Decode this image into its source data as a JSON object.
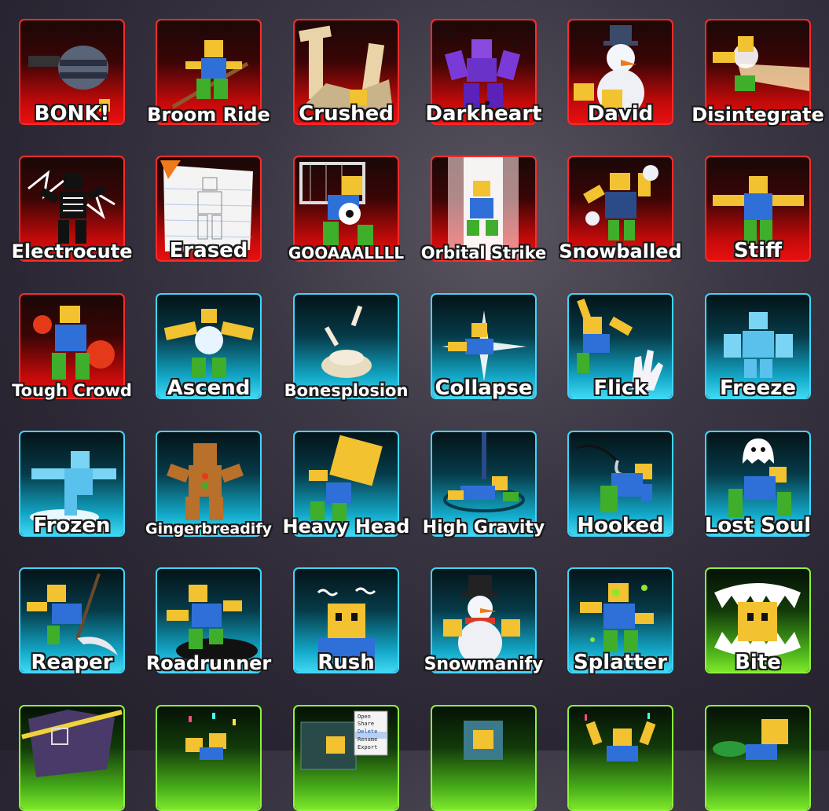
{
  "emotes": [
    {
      "name": "BONK!",
      "rarity": "red",
      "icon": "bonk-hammer-icon"
    },
    {
      "name": "Broom Ride",
      "rarity": "red",
      "icon": "broom-ride-icon"
    },
    {
      "name": "Crushed",
      "rarity": "red",
      "icon": "crushed-icon"
    },
    {
      "name": "Darkheart",
      "rarity": "red",
      "icon": "darkheart-icon"
    },
    {
      "name": "David",
      "rarity": "red",
      "icon": "snowman-hat-icon"
    },
    {
      "name": "Disintegrate",
      "rarity": "red",
      "icon": "disintegrate-icon"
    },
    {
      "name": "Electrocute",
      "rarity": "red",
      "icon": "skeleton-icon"
    },
    {
      "name": "Erased",
      "rarity": "red",
      "icon": "paper-sketch-icon"
    },
    {
      "name": "GOOAAALLLL",
      "rarity": "red",
      "icon": "soccer-goal-icon"
    },
    {
      "name": "Orbital Strike",
      "rarity": "red",
      "icon": "orbital-beam-icon"
    },
    {
      "name": "Snowballed",
      "rarity": "red",
      "icon": "snowball-icon"
    },
    {
      "name": "Stiff",
      "rarity": "red",
      "icon": "tpose-icon"
    },
    {
      "name": "Tough Crowd",
      "rarity": "red",
      "icon": "tomato-icon"
    },
    {
      "name": "Ascend",
      "rarity": "cyan",
      "icon": "ascend-glow-icon"
    },
    {
      "name": "Bonesplosion",
      "rarity": "cyan",
      "icon": "bones-icon"
    },
    {
      "name": "Collapse",
      "rarity": "cyan",
      "icon": "collapse-flash-icon"
    },
    {
      "name": "Flick",
      "rarity": "cyan",
      "icon": "flick-hand-icon"
    },
    {
      "name": "Freeze",
      "rarity": "cyan",
      "icon": "ice-figure-icon"
    },
    {
      "name": "Frozen",
      "rarity": "cyan",
      "icon": "frozen-figure-icon"
    },
    {
      "name": "Gingerbreadify",
      "rarity": "cyan",
      "icon": "gingerbread-icon"
    },
    {
      "name": "Heavy Head",
      "rarity": "cyan",
      "icon": "big-head-icon"
    },
    {
      "name": "High Gravity",
      "rarity": "cyan",
      "icon": "gravity-icon"
    },
    {
      "name": "Hooked",
      "rarity": "cyan",
      "icon": "fishing-hook-icon"
    },
    {
      "name": "Lost Soul",
      "rarity": "cyan",
      "icon": "ghost-icon"
    },
    {
      "name": "Reaper",
      "rarity": "cyan",
      "icon": "scythe-icon"
    },
    {
      "name": "Roadrunner",
      "rarity": "cyan",
      "icon": "hole-icon"
    },
    {
      "name": "Rush",
      "rarity": "cyan",
      "icon": "rush-head-icon"
    },
    {
      "name": "Snowmanify",
      "rarity": "cyan",
      "icon": "snowman-icon"
    },
    {
      "name": "Splatter",
      "rarity": "cyan",
      "icon": "splatter-icon"
    },
    {
      "name": "Bite",
      "rarity": "green",
      "icon": "teeth-bite-icon"
    },
    {
      "name": "",
      "rarity": "green",
      "icon": "crime-scene-icon"
    },
    {
      "name": "",
      "rarity": "green",
      "icon": "confetti-icon"
    },
    {
      "name": "",
      "rarity": "green",
      "icon": "context-menu-icon"
    },
    {
      "name": "",
      "rarity": "green",
      "icon": "box-figure-icon"
    },
    {
      "name": "",
      "rarity": "green",
      "icon": "celebrate-icon"
    },
    {
      "name": "",
      "rarity": "green",
      "icon": "leaf-figure-icon"
    }
  ],
  "context_menu": [
    "Open",
    "Share",
    "Delete",
    "Rename",
    "Export"
  ],
  "colors": {
    "red": "#e81010",
    "cyan": "#3fd8f2",
    "green": "#7ee82a",
    "skin": "#f2c230",
    "shirt": "#2f6fd8",
    "pants": "#3fae2a"
  }
}
